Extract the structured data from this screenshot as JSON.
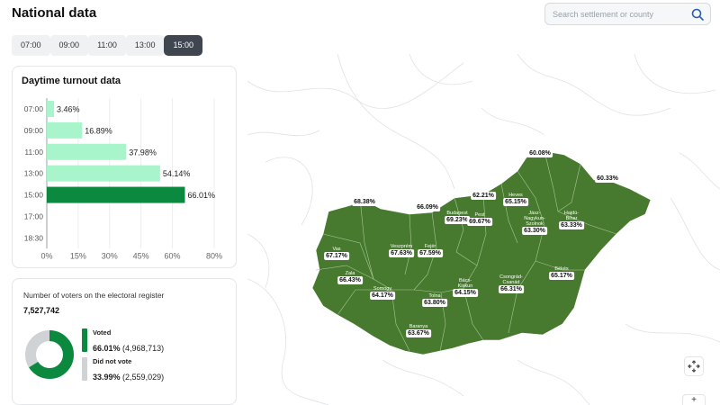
{
  "header": {
    "title": "National data"
  },
  "search": {
    "placeholder": "Search settlement or county"
  },
  "tabs": [
    {
      "label": "07:00",
      "active": false
    },
    {
      "label": "09:00",
      "active": false
    },
    {
      "label": "11:00",
      "active": false
    },
    {
      "label": "13:00",
      "active": false
    },
    {
      "label": "15:00",
      "active": true
    }
  ],
  "turnout": {
    "title": "Daytime turnout data"
  },
  "chart_data": {
    "type": "bar",
    "orientation": "horizontal",
    "title": "Daytime turnout data",
    "categories": [
      "07:00",
      "09:00",
      "11:00",
      "13:00",
      "15:00",
      "17:00",
      "18:30"
    ],
    "values": [
      3.46,
      16.89,
      37.98,
      54.14,
      66.01,
      null,
      null
    ],
    "value_labels": [
      "3.46%",
      "16.89%",
      "37.98%",
      "54.14%",
      "66.01%",
      "",
      ""
    ],
    "xticks": [
      "0%",
      "15%",
      "30%",
      "45%",
      "60%",
      "80%"
    ],
    "xtick_values": [
      0,
      15,
      30,
      45,
      60,
      80
    ],
    "xlim": [
      0,
      80
    ],
    "highlight_index": 4,
    "colors": {
      "bar": "#a8f5cc",
      "highlight": "#0b8a3f"
    }
  },
  "voters": {
    "register_label": "Number of voters on the electoral register",
    "register_value": "7,527,742",
    "voted_label": "Voted",
    "voted_pct": "66.01%",
    "voted_count": "(4,968,713)",
    "voted_fraction": 0.6601,
    "not_voted_label": "Did not vote",
    "not_voted_pct": "33.99%",
    "not_voted_count": "(2,559,029)",
    "colors": {
      "voted": "#0b8a3f",
      "not_voted": "#d0d3d6"
    }
  },
  "map": {
    "fill_color": "#477a2e",
    "counties": [
      {
        "name": "Borsod-\nAbaúj-\nZemplén",
        "pct": "60.08%"
      },
      {
        "name": "Szabolcs-\nSzatmár-\nBereg",
        "pct": "60.33%"
      },
      {
        "name": "Nógrád",
        "pct": "62.21%"
      },
      {
        "name": "Heves",
        "pct": "65.15%"
      },
      {
        "name": "Győr-\nMoson-\nSopron",
        "pct": "68.38%"
      },
      {
        "name": "Komárom-\nEsztergom",
        "pct": "66.09%"
      },
      {
        "name": "Budapest",
        "pct": "69.23%"
      },
      {
        "name": "Pest",
        "pct": "69.67%"
      },
      {
        "name": "Hajdú-\nBihar",
        "pct": "63.33%"
      },
      {
        "name": "Jász-\nNagykun-\nSzolnok",
        "pct": "63.30%"
      },
      {
        "name": "Vas",
        "pct": "67.17%"
      },
      {
        "name": "Veszprém",
        "pct": "67.63%"
      },
      {
        "name": "Fejér",
        "pct": "67.59%"
      },
      {
        "name": "Zala",
        "pct": "66.43%"
      },
      {
        "name": "Békés",
        "pct": "65.17%"
      },
      {
        "name": "Somogy",
        "pct": "64.17%"
      },
      {
        "name": "Csongrád-\nCsanád",
        "pct": "66.31%"
      },
      {
        "name": "Tolna",
        "pct": "63.80%"
      },
      {
        "name": "Bács-\nKiskun",
        "pct": "64.15%"
      },
      {
        "name": "Baranya",
        "pct": "63.67%"
      }
    ]
  },
  "icons": {
    "search": "search-icon",
    "fullscreen": "fullscreen-icon",
    "zoom_in": "plus-icon"
  }
}
